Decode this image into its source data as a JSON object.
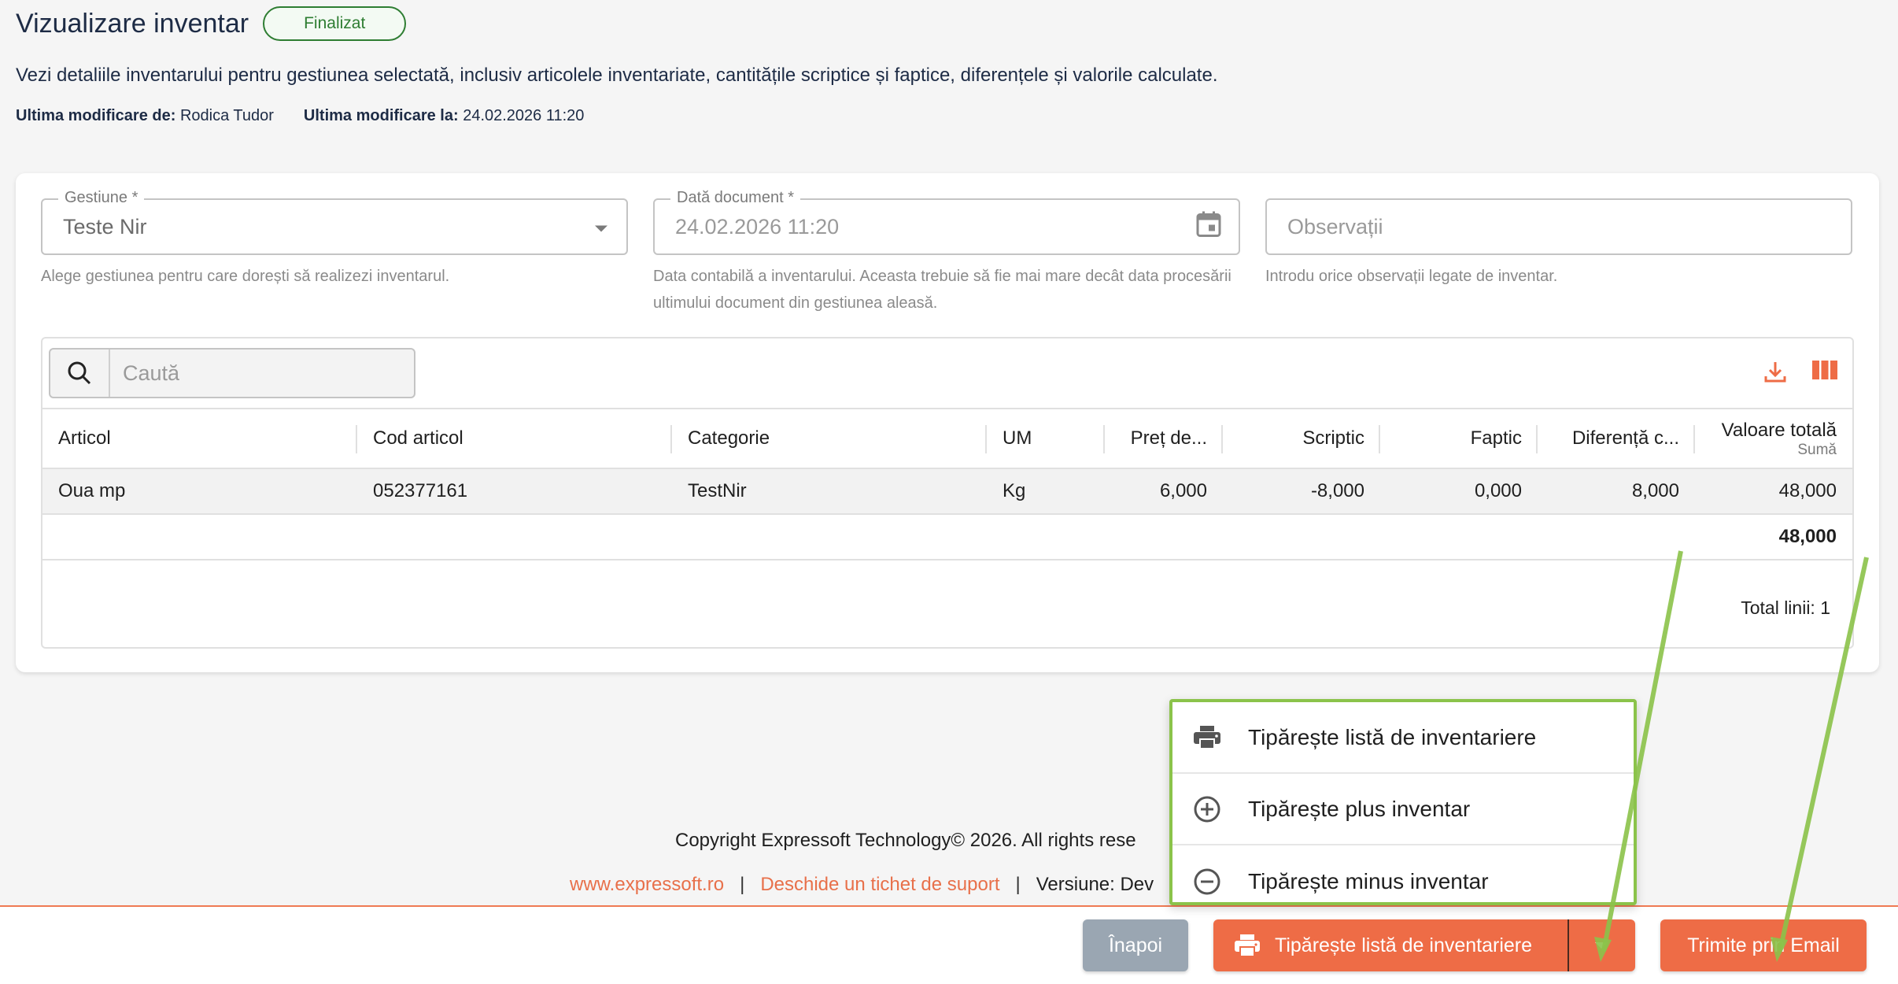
{
  "header": {
    "title": "Vizualizare inventar",
    "status": "Finalizat",
    "description": "Vezi detaliile inventarului pentru gestiunea selectată, inclusiv articolele inventariate, cantitățile scriptice și faptice, diferențele și valorile calculate.",
    "modified_by_label": "Ultima modificare de:",
    "modified_by_value": "Rodica Tudor",
    "modified_at_label": "Ultima modificare la:",
    "modified_at_value": "24.02.2026 11:20"
  },
  "form": {
    "gestiune": {
      "label": "Gestiune *",
      "value": "Teste Nir",
      "help": "Alege gestiunea pentru care dorești să realizezi inventarul."
    },
    "data_document": {
      "label": "Dată document *",
      "value": "24.02.2026 11:20",
      "help": "Data contabilă a inventarului. Aceasta trebuie să fie mai mare decât data procesării ultimului document din gestiunea aleasă."
    },
    "observatii": {
      "placeholder": "Observații",
      "help": "Introdu orice observații legate de inventar."
    }
  },
  "table": {
    "search_placeholder": "Caută",
    "columns": [
      "Articol",
      "Cod articol",
      "Categorie",
      "UM",
      "Preț de...",
      "Scriptic",
      "Faptic",
      "Diferență c...",
      "Valoare totală"
    ],
    "total_column_sub": "Sumă",
    "rows": [
      [
        "Oua mp",
        "052377161",
        "TestNir",
        "Kg",
        "6,000",
        "-8,000",
        "0,000",
        "8,000",
        "48,000"
      ]
    ],
    "total_value": "48,000",
    "total_lines": "Total linii: 1"
  },
  "footer": {
    "copyright": "Copyright Expressoft Technology© 2026. All rights rese",
    "link_site": "www.expressoft.ro",
    "link_ticket": "Deschide un tichet de suport",
    "version": "Versiune: Dev"
  },
  "menu": {
    "items": [
      {
        "label": "Tipărește listă de inventariere",
        "icon": "printer-icon"
      },
      {
        "label": "Tipărește plus inventar",
        "icon": "plus-circle-icon"
      },
      {
        "label": "Tipărește minus inventar",
        "icon": "minus-circle-icon"
      }
    ]
  },
  "actions": {
    "back": "Înapoi",
    "print": "Tipărește listă de inventariere",
    "email": "Trimite prin Email"
  },
  "colors": {
    "accent": "#ee6c46",
    "status_green": "#2e7d32",
    "highlight": "#8bc34a",
    "back_button": "#9aa6b2"
  }
}
